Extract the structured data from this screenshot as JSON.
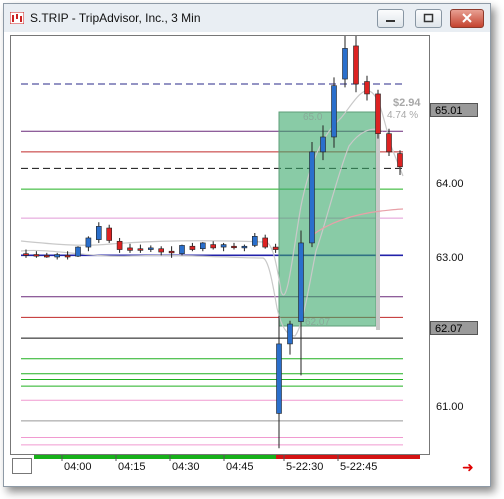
{
  "window": {
    "title": "S.TRIP - TripAdvisor, Inc., 3 Min",
    "icons": [
      "chart-app-icon",
      "minimize-icon",
      "maximize-icon",
      "close-icon"
    ]
  },
  "price_axis": {
    "labels": [
      "65.01",
      "64.00",
      "63.00",
      "62.07",
      "61.00"
    ],
    "highlighted": [
      "65.01",
      "62.07"
    ]
  },
  "time_axis": {
    "labels": [
      "04:00",
      "04:15",
      "04:30",
      "04:45",
      "5-22:30",
      "5-22:45"
    ]
  },
  "overlay_labels": {
    "change": "$2.94",
    "change_pct": "4.74 %",
    "box_top": "65.0",
    "box_bottom": "62.07"
  },
  "colors": {
    "up_candle": "#2a6fcc",
    "down_candle": "#dd2222",
    "box_fill": "#3aa86b",
    "session_green": "#17b01a",
    "session_red": "#d41313"
  },
  "chart_data": {
    "type": "candlestick",
    "ylim": [
      60.55,
      65.6
    ],
    "candles": [
      {
        "o": 62.97,
        "h": 63.02,
        "l": 62.92,
        "c": 62.95
      },
      {
        "o": 62.96,
        "h": 63.0,
        "l": 62.92,
        "c": 62.94
      },
      {
        "o": 62.95,
        "h": 62.98,
        "l": 62.92,
        "c": 62.93
      },
      {
        "o": 62.93,
        "h": 62.98,
        "l": 62.9,
        "c": 62.96
      },
      {
        "o": 62.95,
        "h": 63.0,
        "l": 62.9,
        "c": 62.93
      },
      {
        "o": 62.94,
        "h": 63.06,
        "l": 62.93,
        "c": 63.05
      },
      {
        "o": 63.05,
        "h": 63.18,
        "l": 63.0,
        "c": 63.16
      },
      {
        "o": 63.14,
        "h": 63.35,
        "l": 63.1,
        "c": 63.3
      },
      {
        "o": 63.28,
        "h": 63.32,
        "l": 63.1,
        "c": 63.13
      },
      {
        "o": 63.12,
        "h": 63.16,
        "l": 62.98,
        "c": 63.02
      },
      {
        "o": 63.04,
        "h": 63.09,
        "l": 62.98,
        "c": 63.01
      },
      {
        "o": 63.03,
        "h": 63.08,
        "l": 62.98,
        "c": 63.01
      },
      {
        "o": 63.02,
        "h": 63.07,
        "l": 62.99,
        "c": 63.04
      },
      {
        "o": 63.03,
        "h": 63.06,
        "l": 62.95,
        "c": 62.99
      },
      {
        "o": 63.0,
        "h": 63.06,
        "l": 62.92,
        "c": 62.98
      },
      {
        "o": 62.97,
        "h": 63.08,
        "l": 62.95,
        "c": 63.07
      },
      {
        "o": 63.06,
        "h": 63.1,
        "l": 63.0,
        "c": 63.02
      },
      {
        "o": 63.03,
        "h": 63.11,
        "l": 63.0,
        "c": 63.1
      },
      {
        "o": 63.08,
        "h": 63.12,
        "l": 63.02,
        "c": 63.04
      },
      {
        "o": 63.05,
        "h": 63.1,
        "l": 63.0,
        "c": 63.08
      },
      {
        "o": 63.06,
        "h": 63.1,
        "l": 63.02,
        "c": 63.05
      },
      {
        "o": 63.04,
        "h": 63.08,
        "l": 63.0,
        "c": 63.06
      },
      {
        "o": 63.07,
        "h": 63.22,
        "l": 63.05,
        "c": 63.18
      },
      {
        "o": 63.16,
        "h": 63.2,
        "l": 63.03,
        "c": 63.05
      },
      {
        "o": 63.05,
        "h": 63.09,
        "l": 62.98,
        "c": 63.02
      },
      {
        "o": 61.04,
        "h": 62.22,
        "l": 60.62,
        "c": 61.88
      },
      {
        "o": 61.88,
        "h": 62.16,
        "l": 61.75,
        "c": 62.12
      },
      {
        "o": 62.15,
        "h": 63.25,
        "l": 61.5,
        "c": 63.1
      },
      {
        "o": 63.1,
        "h": 64.32,
        "l": 63.05,
        "c": 64.2
      },
      {
        "o": 64.2,
        "h": 64.52,
        "l": 64.1,
        "c": 64.38
      },
      {
        "o": 64.38,
        "h": 65.1,
        "l": 64.25,
        "c": 65.0
      },
      {
        "o": 65.08,
        "h": 65.78,
        "l": 64.98,
        "c": 65.45
      },
      {
        "o": 65.48,
        "h": 65.6,
        "l": 64.92,
        "c": 65.02
      },
      {
        "o": 65.05,
        "h": 65.12,
        "l": 64.82,
        "c": 64.9
      },
      {
        "o": 64.9,
        "h": 64.95,
        "l": 64.36,
        "c": 64.42
      },
      {
        "o": 64.42,
        "h": 64.48,
        "l": 64.15,
        "c": 64.2
      },
      {
        "o": 64.18,
        "h": 64.22,
        "l": 63.92,
        "c": 64.02
      }
    ]
  }
}
